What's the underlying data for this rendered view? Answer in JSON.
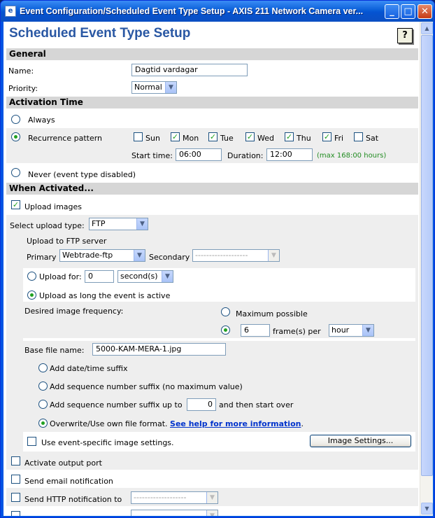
{
  "window": {
    "title": "Event Configuration/Scheduled Event Type Setup - AXIS 211 Network Camera ver...",
    "icon": "ie-page-icon",
    "min": "_",
    "max": "□",
    "close": "✕"
  },
  "page": {
    "title": "Scheduled Event Type Setup",
    "help": "?"
  },
  "general": {
    "heading": "General",
    "name_label": "Name:",
    "name_value": "Dagtid vardagar",
    "priority_label": "Priority:",
    "priority_value": "Normal"
  },
  "activation": {
    "heading": "Activation Time",
    "always_label": "Always",
    "recurrence_label": "Recurrence pattern",
    "days": [
      {
        "label": "Sun",
        "checked": false
      },
      {
        "label": "Mon",
        "checked": true
      },
      {
        "label": "Tue",
        "checked": true
      },
      {
        "label": "Wed",
        "checked": true
      },
      {
        "label": "Thu",
        "checked": true
      },
      {
        "label": "Fri",
        "checked": true
      },
      {
        "label": "Sat",
        "checked": false
      }
    ],
    "start_label": "Start time:",
    "start_value": "06:00",
    "duration_label": "Duration:",
    "duration_value": "12:00",
    "max_note": "(max 168:00 hours)",
    "never_label": "Never (event type disabled)",
    "selected": "recurrence"
  },
  "activated": {
    "heading": "When Activated...",
    "upload_images_label": "Upload images",
    "upload_images_checked": true,
    "upload_type_label": "Select upload type:",
    "upload_type_value": "FTP",
    "ftp_heading": "Upload to FTP server",
    "primary_label": "Primary",
    "primary_value": "Webtrade-ftp",
    "secondary_label": "Secondary",
    "secondary_value": "-------------------",
    "upload_for_label": "Upload for:",
    "upload_for_value": "0",
    "upload_for_unit": "second(s)",
    "upload_active_label": "Upload as long the event is active",
    "frequency_label": "Desired image frequency:",
    "max_possible_label": "Maximum possible",
    "frames_value": "6",
    "frames_label": "frame(s) per",
    "frames_unit": "hour",
    "base_name_label": "Base file name:",
    "base_name_value": "5000-KAM-MERA-1.jpg",
    "suffix_datetime_label": "Add date/time suffix",
    "suffix_seq_label": "Add sequence number suffix (no maximum value)",
    "suffix_seq_upto_label": "Add sequence number suffix up to",
    "suffix_seq_upto_value": "0",
    "suffix_seq_upto_after": "and then start over",
    "overwrite_label": "Overwrite/Use own file format.",
    "help_link": "See help for more information",
    "help_link_after": ".",
    "event_settings_label": "Use event-specific image settings.",
    "image_settings_button": "Image Settings...",
    "output_port_label": "Activate output port",
    "email_label": "Send email notification",
    "http_label": "Send HTTP notification to",
    "http_value": "-------------------"
  },
  "scrollbar": {
    "up": "▲",
    "down": "▼"
  }
}
